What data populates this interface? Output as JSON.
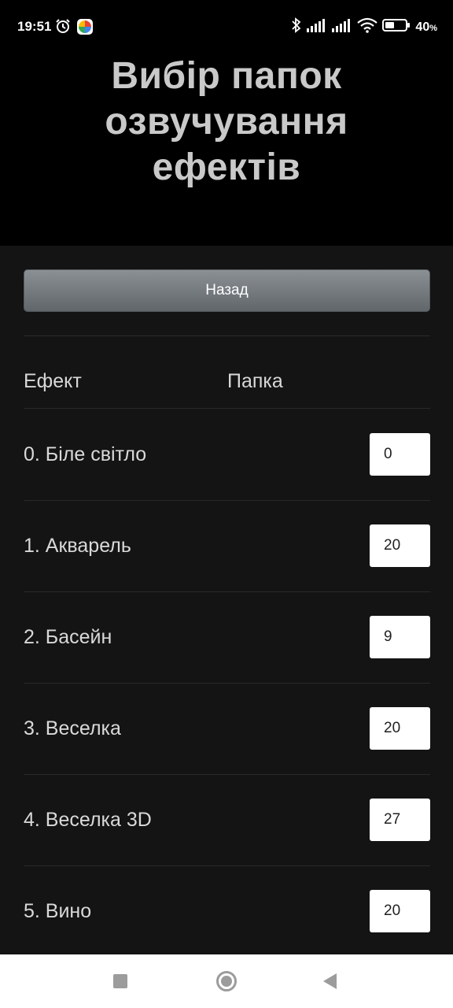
{
  "status_bar": {
    "time": "19:51",
    "battery_percent": "40",
    "battery_unit": "%",
    "icons": [
      "alarm-icon",
      "app-notification-icon",
      "bluetooth-icon",
      "signal-icon",
      "signal-icon",
      "wifi-icon",
      "battery-icon"
    ]
  },
  "header": {
    "title": "Вибір папок озвучування ефектів"
  },
  "toolbar": {
    "back_label": "Назад"
  },
  "table": {
    "columns": [
      "Ефект",
      "Папка"
    ],
    "rows": [
      {
        "label": "0. Біле світло",
        "folder": "0"
      },
      {
        "label": "1. Акварель",
        "folder": "20"
      },
      {
        "label": "2. Басейн",
        "folder": "9"
      },
      {
        "label": "3. Веселка",
        "folder": "20"
      },
      {
        "label": "4. Веселка 3D",
        "folder": "27"
      },
      {
        "label": "5. Вино",
        "folder": "20"
      }
    ]
  },
  "nav_bar": {
    "icons": [
      "recents-square-icon",
      "home-circle-icon",
      "back-triangle-icon"
    ]
  },
  "colors": {
    "background": "#000000",
    "content_background": "#141414",
    "title_text": "#c9c9c9",
    "button_gradient_top": "#8b9095",
    "button_gradient_bottom": "#61666b"
  }
}
